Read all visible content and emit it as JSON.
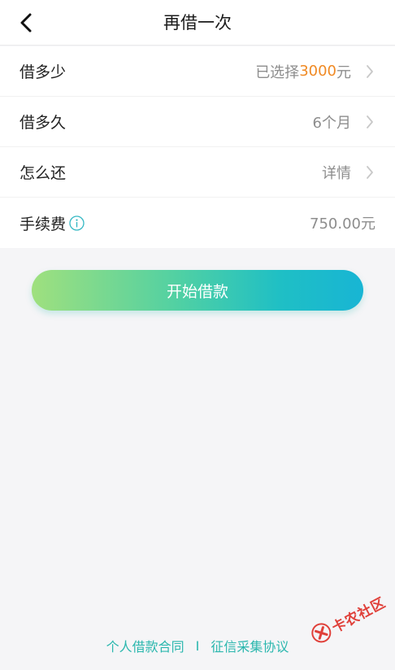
{
  "header": {
    "title": "再借一次"
  },
  "rows": {
    "amount": {
      "label": "借多少",
      "value_prefix": "已选择",
      "value_highlight": "3000",
      "value_suffix": "元"
    },
    "term": {
      "label": "借多久",
      "value": "6个月"
    },
    "repay": {
      "label": "怎么还",
      "value": "详情"
    },
    "fee": {
      "label": "手续费",
      "value": "750.00元"
    }
  },
  "primary_button": {
    "label": "开始借款"
  },
  "footer": {
    "link1": "个人借款合同",
    "separator": "I",
    "link2": "征信采集协议"
  },
  "watermark": {
    "text": "卡农社区"
  },
  "colors": {
    "accent": "#f08a24",
    "link": "#2bb7ae",
    "button_start": "#9fe07e",
    "button_end": "#18b5d4"
  }
}
